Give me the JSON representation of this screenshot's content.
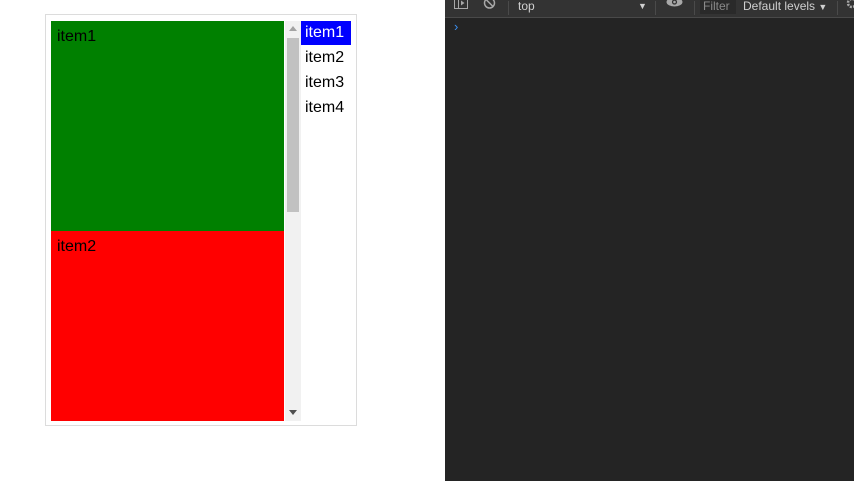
{
  "panels": [
    {
      "label": "item1",
      "color": "#008000"
    },
    {
      "label": "item2",
      "color": "#ff0000"
    }
  ],
  "nav": {
    "items": [
      {
        "label": "item1"
      },
      {
        "label": "item2"
      },
      {
        "label": "item3"
      },
      {
        "label": "item4"
      }
    ],
    "active_color": "#0000ff"
  },
  "devtools": {
    "context": "top",
    "filter_placeholder": "Filter",
    "levels": "Default levels",
    "prompt_symbol": "›",
    "background": "#242424",
    "prompt_color": "#3b8ff0"
  }
}
